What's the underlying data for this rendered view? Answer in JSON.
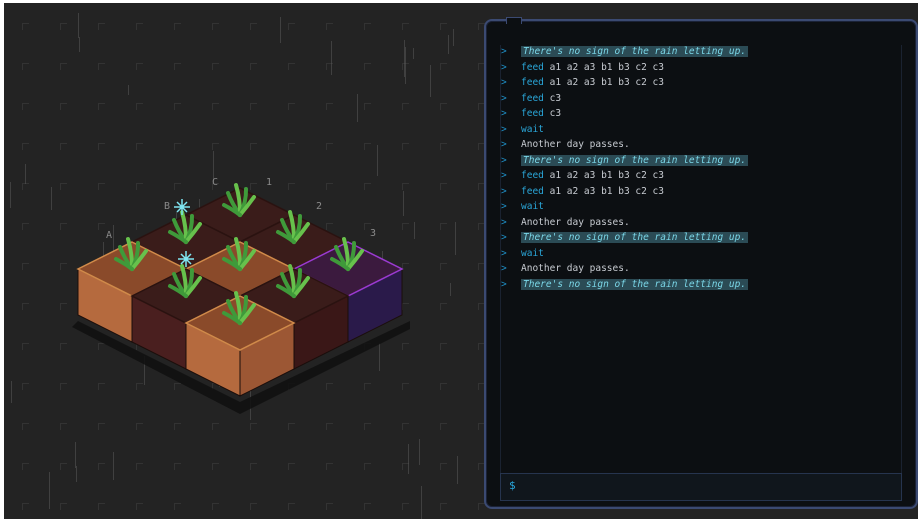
{
  "garden": {
    "row_labels": [
      "A",
      "B",
      "C"
    ],
    "col_labels": [
      "1",
      "2",
      "3"
    ],
    "plots": [
      {
        "id": "a1",
        "soil": "light",
        "plant": "sprout"
      },
      {
        "id": "a2",
        "soil": "dark",
        "plant": "sprout"
      },
      {
        "id": "a3",
        "soil": "light",
        "plant": "sprout"
      },
      {
        "id": "b1",
        "soil": "dark",
        "plant": "sprout"
      },
      {
        "id": "b2",
        "soil": "light",
        "plant": "sprout"
      },
      {
        "id": "b3",
        "soil": "dark",
        "plant": "sprout"
      },
      {
        "id": "c1",
        "soil": "dark",
        "plant": "sprout"
      },
      {
        "id": "c2",
        "soil": "dark",
        "plant": "sprout"
      },
      {
        "id": "c3",
        "soil": "purple",
        "plant": "sprout"
      }
    ],
    "colors": {
      "light_top": "#8a4a2a",
      "light_side_l": "#b56a3e",
      "light_side_r": "#9c5734",
      "dark_top": "#3a1c1a",
      "dark_side_l": "#4a1f1f",
      "dark_side_r": "#3a1717",
      "purple_top": "#3b1a3e",
      "purple_side_l": "#3d1f52",
      "purple_side_r": "#2a1a4a",
      "leaf": "#3f9a3a",
      "leaf_light": "#67c14c",
      "sparkle": "#7fe6f2"
    }
  },
  "terminal": {
    "lines": [
      {
        "kind": "narration",
        "text": "There's no sign of the rain letting up."
      },
      {
        "kind": "command",
        "cmd": "feed",
        "args": "a1 a2 a3 b1 b3 c2 c3"
      },
      {
        "kind": "command",
        "cmd": "feed",
        "args": "a1 a2 a3 b1 b3 c2 c3"
      },
      {
        "kind": "command",
        "cmd": "feed",
        "args": "c3"
      },
      {
        "kind": "command",
        "cmd": "feed",
        "args": "c3"
      },
      {
        "kind": "command",
        "cmd": "wait",
        "args": ""
      },
      {
        "kind": "plain",
        "text": "Another day passes."
      },
      {
        "kind": "narration",
        "text": "There's no sign of the rain letting up."
      },
      {
        "kind": "command",
        "cmd": "feed",
        "args": "a1 a2 a3 b1 b3 c2 c3"
      },
      {
        "kind": "command",
        "cmd": "feed",
        "args": "a1 a2 a3 b1 b3 c2 c3"
      },
      {
        "kind": "command",
        "cmd": "wait",
        "args": ""
      },
      {
        "kind": "plain",
        "text": "Another day passes."
      },
      {
        "kind": "narration",
        "text": "There's no sign of the rain letting up."
      },
      {
        "kind": "command",
        "cmd": "wait",
        "args": ""
      },
      {
        "kind": "plain",
        "text": "Another day passes."
      },
      {
        "kind": "narration",
        "text": "There's no sign of the rain letting up."
      }
    ],
    "prompt_marker": ">",
    "input_prompt": "$",
    "input_value": ""
  }
}
